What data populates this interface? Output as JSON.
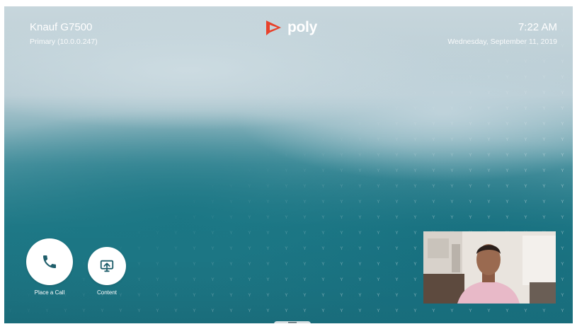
{
  "device": {
    "name": "Knauf G7500",
    "address": "Primary (10.0.0.247)"
  },
  "brand": {
    "logo_text": "poly",
    "logo_icon": "poly-logo-icon",
    "accent": "#e8412a"
  },
  "clock": {
    "time": "7:22 AM",
    "date": "Wednesday, September 11, 2019"
  },
  "actions": [
    {
      "label": "Place a Call",
      "icon": "phone-icon"
    },
    {
      "label": "Content",
      "icon": "screen-share-icon"
    }
  ],
  "menu_handle": {
    "icon": "menu-icon"
  },
  "self_view": {
    "description_icon": "camera-preview"
  },
  "colors": {
    "background_top": "#c7d6dc",
    "background_bottom": "#1a6c7a",
    "text": "#ffffff",
    "icon_dark": "#1f5e6b"
  }
}
